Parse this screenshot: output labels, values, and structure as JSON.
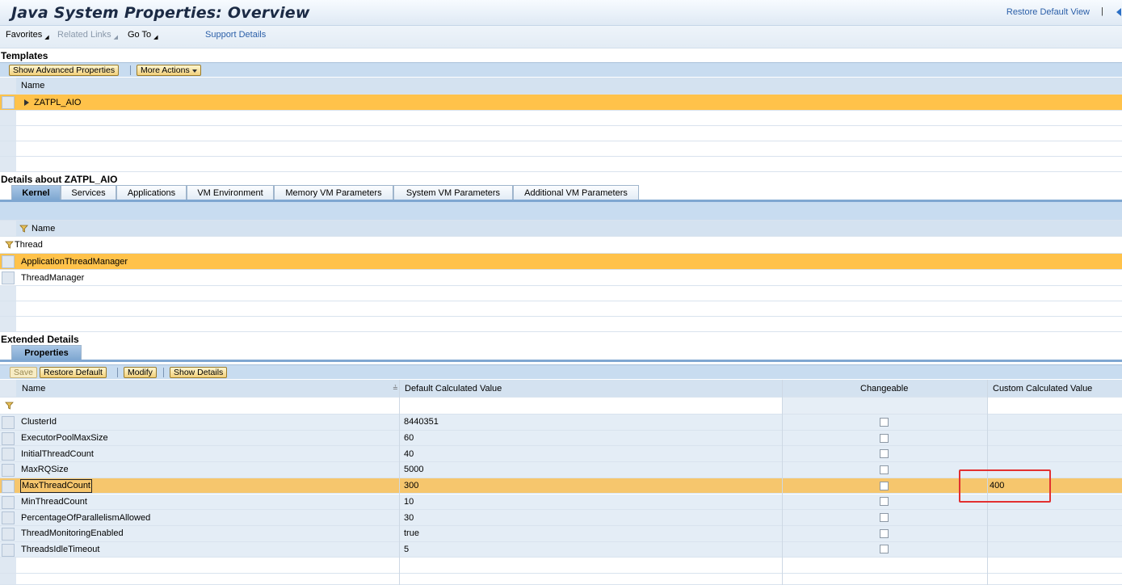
{
  "header": {
    "title": "Java System Properties: Overview",
    "restore_default_view": "Restore Default View",
    "separator": "|"
  },
  "menubar": {
    "favorites": "Favorites",
    "related_links": "Related Links",
    "go_to": "Go To",
    "support_details": "Support Details"
  },
  "templates": {
    "title": "Templates",
    "buttons": {
      "show_advanced": "Show Advanced Properties",
      "more_actions": "More Actions"
    },
    "column_name": "Name",
    "rows": [
      "ZATPL_AIO"
    ]
  },
  "details": {
    "title": "Details about ZATPL_AIO",
    "tabs": [
      "Kernel",
      "Services",
      "Applications",
      "VM Environment",
      "Memory VM Parameters",
      "System VM Parameters",
      "Additional VM Parameters"
    ],
    "column_name": "Name",
    "filter_value": "Thread",
    "rows": [
      "ApplicationThreadManager",
      "ThreadManager"
    ]
  },
  "extended": {
    "title": "Extended Details",
    "tab": "Properties",
    "buttons": {
      "save": "Save",
      "restore_default": "Restore Default",
      "modify": "Modify",
      "show_details": "Show Details"
    },
    "columns": {
      "name": "Name",
      "default_value": "Default Calculated Value",
      "changeable": "Changeable",
      "custom_value": "Custom Calculated Value"
    },
    "rows": [
      {
        "name": "ClusterId",
        "default": "8440351",
        "custom": ""
      },
      {
        "name": "ExecutorPoolMaxSize",
        "default": "60",
        "custom": ""
      },
      {
        "name": "InitialThreadCount",
        "default": "40",
        "custom": ""
      },
      {
        "name": "MaxRQSize",
        "default": "5000",
        "custom": ""
      },
      {
        "name": "MaxThreadCount",
        "default": "300",
        "custom": "400"
      },
      {
        "name": "MinThreadCount",
        "default": "10",
        "custom": ""
      },
      {
        "name": "PercentageOfParallelismAllowed",
        "default": "30",
        "custom": ""
      },
      {
        "name": "ThreadMonitoringEnabled",
        "default": "true",
        "custom": ""
      },
      {
        "name": "ThreadsIdleTimeout",
        "default": "5",
        "custom": ""
      }
    ]
  },
  "colors": {
    "selected_row": "#ffc24a",
    "highlight_box": "#e23030",
    "header_bg": "#d4e2f0"
  }
}
